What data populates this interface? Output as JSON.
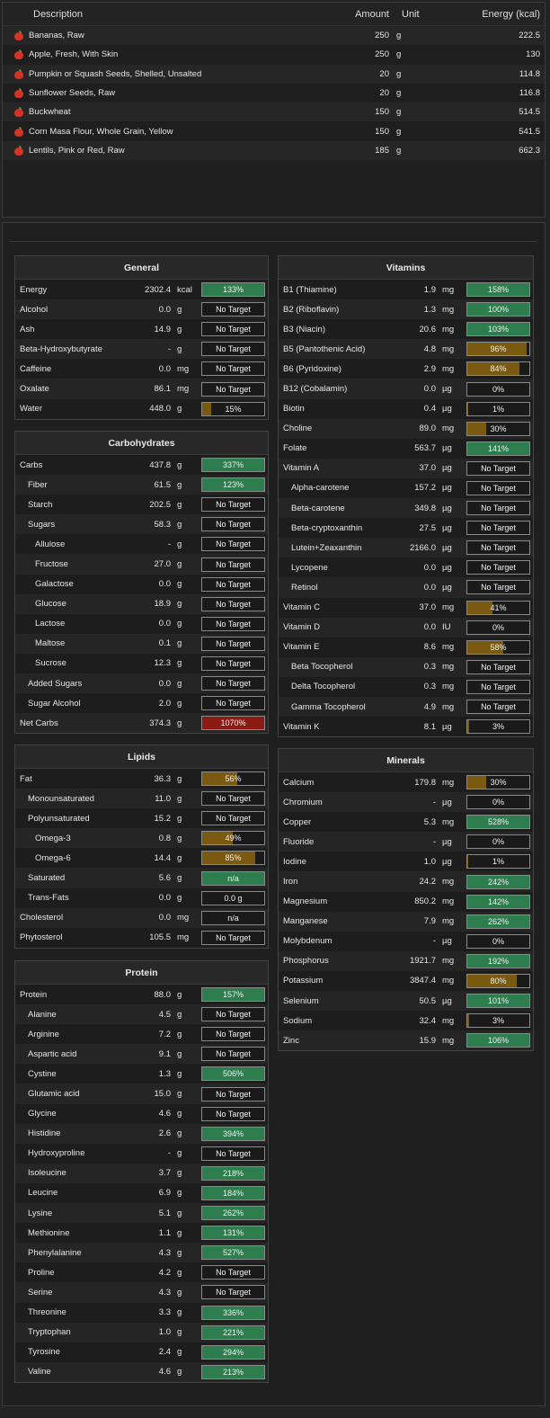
{
  "colors": {
    "green": "#2e7d4f",
    "orange": "#7a5a10",
    "red": "#8b1a12",
    "background": "#232323"
  },
  "food": {
    "headers": {
      "description": "Description",
      "amount": "Amount",
      "unit": "Unit",
      "energy": "Energy (kcal)"
    },
    "icon": "apple-icon",
    "rows": [
      {
        "desc": "Bananas, Raw",
        "amount": "250",
        "unit": "g",
        "energy": "222.5"
      },
      {
        "desc": "Apple, Fresh, With Skin",
        "amount": "250",
        "unit": "g",
        "energy": "130"
      },
      {
        "desc": "Pumpkin or Squash Seeds, Shelled, Unsalted",
        "amount": "20",
        "unit": "g",
        "energy": "114.8"
      },
      {
        "desc": "Sunflower Seeds, Raw",
        "amount": "20",
        "unit": "g",
        "energy": "116.8"
      },
      {
        "desc": "Buckwheat",
        "amount": "150",
        "unit": "g",
        "energy": "514.5"
      },
      {
        "desc": "Corn Masa Flour, Whole Grain, Yellow",
        "amount": "150",
        "unit": "g",
        "energy": "541.5"
      },
      {
        "desc": "Lentils, Pink or Red, Raw",
        "amount": "185",
        "unit": "g",
        "energy": "662.3"
      }
    ]
  },
  "sections": {
    "general": {
      "title": "General",
      "rows": [
        {
          "name": "Energy",
          "value": "2302.4",
          "unit": "kcal",
          "bar": "133%",
          "pct": 133,
          "color": "green",
          "indent": 0
        },
        {
          "name": "Alcohol",
          "value": "0.0",
          "unit": "g",
          "bar": "No Target",
          "pct": 0,
          "color": "none",
          "indent": 0
        },
        {
          "name": "Ash",
          "value": "14.9",
          "unit": "g",
          "bar": "No Target",
          "pct": 0,
          "color": "none",
          "indent": 0
        },
        {
          "name": "Beta-Hydroxybutyrate",
          "value": "-",
          "unit": "g",
          "bar": "No Target",
          "pct": 0,
          "color": "none",
          "indent": 0
        },
        {
          "name": "Caffeine",
          "value": "0.0",
          "unit": "mg",
          "bar": "No Target",
          "pct": 0,
          "color": "none",
          "indent": 0
        },
        {
          "name": "Oxalate",
          "value": "86.1",
          "unit": "mg",
          "bar": "No Target",
          "pct": 0,
          "color": "none",
          "indent": 0
        },
        {
          "name": "Water",
          "value": "448.0",
          "unit": "g",
          "bar": "15%",
          "pct": 15,
          "color": "orange",
          "indent": 0
        }
      ]
    },
    "carbs": {
      "title": "Carbohydrates",
      "rows": [
        {
          "name": "Carbs",
          "value": "437.8",
          "unit": "g",
          "bar": "337%",
          "pct": 337,
          "color": "green",
          "indent": 0
        },
        {
          "name": "Fiber",
          "value": "61.5",
          "unit": "g",
          "bar": "123%",
          "pct": 123,
          "color": "green",
          "indent": 1
        },
        {
          "name": "Starch",
          "value": "202.5",
          "unit": "g",
          "bar": "No Target",
          "pct": 0,
          "color": "none",
          "indent": 1
        },
        {
          "name": "Sugars",
          "value": "58.3",
          "unit": "g",
          "bar": "No Target",
          "pct": 0,
          "color": "none",
          "indent": 1
        },
        {
          "name": "Allulose",
          "value": "-",
          "unit": "g",
          "bar": "No Target",
          "pct": 0,
          "color": "none",
          "indent": 2
        },
        {
          "name": "Fructose",
          "value": "27.0",
          "unit": "g",
          "bar": "No Target",
          "pct": 0,
          "color": "none",
          "indent": 2
        },
        {
          "name": "Galactose",
          "value": "0.0",
          "unit": "g",
          "bar": "No Target",
          "pct": 0,
          "color": "none",
          "indent": 2
        },
        {
          "name": "Glucose",
          "value": "18.9",
          "unit": "g",
          "bar": "No Target",
          "pct": 0,
          "color": "none",
          "indent": 2
        },
        {
          "name": "Lactose",
          "value": "0.0",
          "unit": "g",
          "bar": "No Target",
          "pct": 0,
          "color": "none",
          "indent": 2
        },
        {
          "name": "Maltose",
          "value": "0.1",
          "unit": "g",
          "bar": "No Target",
          "pct": 0,
          "color": "none",
          "indent": 2
        },
        {
          "name": "Sucrose",
          "value": "12.3",
          "unit": "g",
          "bar": "No Target",
          "pct": 0,
          "color": "none",
          "indent": 2
        },
        {
          "name": "Added Sugars",
          "value": "0.0",
          "unit": "g",
          "bar": "No Target",
          "pct": 0,
          "color": "none",
          "indent": 1
        },
        {
          "name": "Sugar Alcohol",
          "value": "2.0",
          "unit": "g",
          "bar": "No Target",
          "pct": 0,
          "color": "none",
          "indent": 1
        },
        {
          "name": "Net Carbs",
          "value": "374.3",
          "unit": "g",
          "bar": "1070%",
          "pct": 1070,
          "color": "red",
          "indent": 0
        }
      ]
    },
    "lipids": {
      "title": "Lipids",
      "rows": [
        {
          "name": "Fat",
          "value": "36.3",
          "unit": "g",
          "bar": "56%",
          "pct": 56,
          "color": "orange",
          "indent": 0
        },
        {
          "name": "Monounsaturated",
          "value": "11.0",
          "unit": "g",
          "bar": "No Target",
          "pct": 0,
          "color": "none",
          "indent": 1
        },
        {
          "name": "Polyunsaturated",
          "value": "15.2",
          "unit": "g",
          "bar": "No Target",
          "pct": 0,
          "color": "none",
          "indent": 1
        },
        {
          "name": "Omega-3",
          "value": "0.8",
          "unit": "g",
          "bar": "49%",
          "pct": 49,
          "color": "orange",
          "indent": 2
        },
        {
          "name": "Omega-6",
          "value": "14.4",
          "unit": "g",
          "bar": "85%",
          "pct": 85,
          "color": "orange",
          "indent": 2
        },
        {
          "name": "Saturated",
          "value": "5.6",
          "unit": "g",
          "bar": "n/a",
          "pct": 100,
          "color": "green",
          "indent": 1
        },
        {
          "name": "Trans-Fats",
          "value": "0.0",
          "unit": "g",
          "bar": "0.0 g",
          "pct": 0,
          "color": "none",
          "indent": 1
        },
        {
          "name": "Cholesterol",
          "value": "0.0",
          "unit": "mg",
          "bar": "n/a",
          "pct": 0,
          "color": "none",
          "indent": 0
        },
        {
          "name": "Phytosterol",
          "value": "105.5",
          "unit": "mg",
          "bar": "No Target",
          "pct": 0,
          "color": "none",
          "indent": 0
        }
      ]
    },
    "protein": {
      "title": "Protein",
      "rows": [
        {
          "name": "Protein",
          "value": "88.0",
          "unit": "g",
          "bar": "157%",
          "pct": 157,
          "color": "green",
          "indent": 0
        },
        {
          "name": "Alanine",
          "value": "4.5",
          "unit": "g",
          "bar": "No Target",
          "pct": 0,
          "color": "none",
          "indent": 1
        },
        {
          "name": "Arginine",
          "value": "7.2",
          "unit": "g",
          "bar": "No Target",
          "pct": 0,
          "color": "none",
          "indent": 1
        },
        {
          "name": "Aspartic acid",
          "value": "9.1",
          "unit": "g",
          "bar": "No Target",
          "pct": 0,
          "color": "none",
          "indent": 1
        },
        {
          "name": "Cystine",
          "value": "1.3",
          "unit": "g",
          "bar": "506%",
          "pct": 506,
          "color": "green",
          "indent": 1
        },
        {
          "name": "Glutamic acid",
          "value": "15.0",
          "unit": "g",
          "bar": "No Target",
          "pct": 0,
          "color": "none",
          "indent": 1
        },
        {
          "name": "Glycine",
          "value": "4.6",
          "unit": "g",
          "bar": "No Target",
          "pct": 0,
          "color": "none",
          "indent": 1
        },
        {
          "name": "Histidine",
          "value": "2.6",
          "unit": "g",
          "bar": "394%",
          "pct": 394,
          "color": "green",
          "indent": 1
        },
        {
          "name": "Hydroxyproline",
          "value": "-",
          "unit": "g",
          "bar": "No Target",
          "pct": 0,
          "color": "none",
          "indent": 1
        },
        {
          "name": "Isoleucine",
          "value": "3.7",
          "unit": "g",
          "bar": "218%",
          "pct": 218,
          "color": "green",
          "indent": 1
        },
        {
          "name": "Leucine",
          "value": "6.9",
          "unit": "g",
          "bar": "184%",
          "pct": 184,
          "color": "green",
          "indent": 1
        },
        {
          "name": "Lysine",
          "value": "5.1",
          "unit": "g",
          "bar": "262%",
          "pct": 262,
          "color": "green",
          "indent": 1
        },
        {
          "name": "Methionine",
          "value": "1.1",
          "unit": "g",
          "bar": "131%",
          "pct": 131,
          "color": "green",
          "indent": 1
        },
        {
          "name": "Phenylalanine",
          "value": "4.3",
          "unit": "g",
          "bar": "527%",
          "pct": 527,
          "color": "green",
          "indent": 1
        },
        {
          "name": "Proline",
          "value": "4.2",
          "unit": "g",
          "bar": "No Target",
          "pct": 0,
          "color": "none",
          "indent": 1
        },
        {
          "name": "Serine",
          "value": "4.3",
          "unit": "g",
          "bar": "No Target",
          "pct": 0,
          "color": "none",
          "indent": 1
        },
        {
          "name": "Threonine",
          "value": "3.3",
          "unit": "g",
          "bar": "336%",
          "pct": 336,
          "color": "green",
          "indent": 1
        },
        {
          "name": "Tryptophan",
          "value": "1.0",
          "unit": "g",
          "bar": "221%",
          "pct": 221,
          "color": "green",
          "indent": 1
        },
        {
          "name": "Tyrosine",
          "value": "2.4",
          "unit": "g",
          "bar": "294%",
          "pct": 294,
          "color": "green",
          "indent": 1
        },
        {
          "name": "Valine",
          "value": "4.6",
          "unit": "g",
          "bar": "213%",
          "pct": 213,
          "color": "green",
          "indent": 1
        }
      ]
    },
    "vitamins": {
      "title": "Vitamins",
      "rows": [
        {
          "name": "B1 (Thiamine)",
          "value": "1.9",
          "unit": "mg",
          "bar": "158%",
          "pct": 158,
          "color": "green",
          "indent": 0
        },
        {
          "name": "B2 (Riboflavin)",
          "value": "1.3",
          "unit": "mg",
          "bar": "100%",
          "pct": 100,
          "color": "green",
          "indent": 0
        },
        {
          "name": "B3 (Niacin)",
          "value": "20.6",
          "unit": "mg",
          "bar": "103%",
          "pct": 103,
          "color": "green",
          "indent": 0
        },
        {
          "name": "B5 (Pantothenic Acid)",
          "value": "4.8",
          "unit": "mg",
          "bar": "96%",
          "pct": 96,
          "color": "orange",
          "indent": 0
        },
        {
          "name": "B6 (Pyridoxine)",
          "value": "2.9",
          "unit": "mg",
          "bar": "84%",
          "pct": 84,
          "color": "orange",
          "indent": 0
        },
        {
          "name": "B12 (Cobalamin)",
          "value": "0.0",
          "unit": "µg",
          "bar": "0%",
          "pct": 0,
          "color": "orange",
          "indent": 0
        },
        {
          "name": "Biotin",
          "value": "0.4",
          "unit": "µg",
          "bar": "1%",
          "pct": 1,
          "color": "orange",
          "indent": 0
        },
        {
          "name": "Choline",
          "value": "89.0",
          "unit": "mg",
          "bar": "30%",
          "pct": 30,
          "color": "orange",
          "indent": 0
        },
        {
          "name": "Folate",
          "value": "563.7",
          "unit": "µg",
          "bar": "141%",
          "pct": 141,
          "color": "green",
          "indent": 0
        },
        {
          "name": "Vitamin A",
          "value": "37.0",
          "unit": "µg",
          "bar": "No Target",
          "pct": 0,
          "color": "none",
          "indent": 0
        },
        {
          "name": "Alpha-carotene",
          "value": "157.2",
          "unit": "µg",
          "bar": "No Target",
          "pct": 0,
          "color": "none",
          "indent": 1
        },
        {
          "name": "Beta-carotene",
          "value": "349.8",
          "unit": "µg",
          "bar": "No Target",
          "pct": 0,
          "color": "none",
          "indent": 1
        },
        {
          "name": "Beta-cryptoxanthin",
          "value": "27.5",
          "unit": "µg",
          "bar": "No Target",
          "pct": 0,
          "color": "none",
          "indent": 1
        },
        {
          "name": "Lutein+Zeaxanthin",
          "value": "2166.0",
          "unit": "µg",
          "bar": "No Target",
          "pct": 0,
          "color": "none",
          "indent": 1
        },
        {
          "name": "Lycopene",
          "value": "0.0",
          "unit": "µg",
          "bar": "No Target",
          "pct": 0,
          "color": "none",
          "indent": 1
        },
        {
          "name": "Retinol",
          "value": "0.0",
          "unit": "µg",
          "bar": "No Target",
          "pct": 0,
          "color": "none",
          "indent": 1
        },
        {
          "name": "Vitamin C",
          "value": "37.0",
          "unit": "mg",
          "bar": "41%",
          "pct": 41,
          "color": "orange",
          "indent": 0
        },
        {
          "name": "Vitamin D",
          "value": "0.0",
          "unit": "IU",
          "bar": "0%",
          "pct": 0,
          "color": "orange",
          "indent": 0
        },
        {
          "name": "Vitamin E",
          "value": "8.6",
          "unit": "mg",
          "bar": "58%",
          "pct": 58,
          "color": "orange",
          "indent": 0
        },
        {
          "name": "Beta Tocopherol",
          "value": "0.3",
          "unit": "mg",
          "bar": "No Target",
          "pct": 0,
          "color": "none",
          "indent": 1
        },
        {
          "name": "Delta Tocopherol",
          "value": "0.3",
          "unit": "mg",
          "bar": "No Target",
          "pct": 0,
          "color": "none",
          "indent": 1
        },
        {
          "name": "Gamma Tocopherol",
          "value": "4.9",
          "unit": "mg",
          "bar": "No Target",
          "pct": 0,
          "color": "none",
          "indent": 1
        },
        {
          "name": "Vitamin K",
          "value": "8.1",
          "unit": "µg",
          "bar": "3%",
          "pct": 3,
          "color": "orange",
          "indent": 0
        }
      ]
    },
    "minerals": {
      "title": "Minerals",
      "rows": [
        {
          "name": "Calcium",
          "value": "179.8",
          "unit": "mg",
          "bar": "30%",
          "pct": 30,
          "color": "orange",
          "indent": 0
        },
        {
          "name": "Chromium",
          "value": "-",
          "unit": "µg",
          "bar": "0%",
          "pct": 0,
          "color": "orange",
          "indent": 0
        },
        {
          "name": "Copper",
          "value": "5.3",
          "unit": "mg",
          "bar": "528%",
          "pct": 528,
          "color": "green",
          "indent": 0
        },
        {
          "name": "Fluoride",
          "value": "-",
          "unit": "µg",
          "bar": "0%",
          "pct": 0,
          "color": "orange",
          "indent": 0
        },
        {
          "name": "Iodine",
          "value": "1.0",
          "unit": "µg",
          "bar": "1%",
          "pct": 1,
          "color": "orange",
          "indent": 0
        },
        {
          "name": "Iron",
          "value": "24.2",
          "unit": "mg",
          "bar": "242%",
          "pct": 242,
          "color": "green",
          "indent": 0
        },
        {
          "name": "Magnesium",
          "value": "850.2",
          "unit": "mg",
          "bar": "142%",
          "pct": 142,
          "color": "green",
          "indent": 0
        },
        {
          "name": "Manganese",
          "value": "7.9",
          "unit": "mg",
          "bar": "262%",
          "pct": 262,
          "color": "green",
          "indent": 0
        },
        {
          "name": "Molybdenum",
          "value": "-",
          "unit": "µg",
          "bar": "0%",
          "pct": 0,
          "color": "orange",
          "indent": 0
        },
        {
          "name": "Phosphorus",
          "value": "1921.7",
          "unit": "mg",
          "bar": "192%",
          "pct": 192,
          "color": "green",
          "indent": 0
        },
        {
          "name": "Potassium",
          "value": "3847.4",
          "unit": "mg",
          "bar": "80%",
          "pct": 80,
          "color": "orange",
          "indent": 0
        },
        {
          "name": "Selenium",
          "value": "50.5",
          "unit": "µg",
          "bar": "101%",
          "pct": 101,
          "color": "green",
          "indent": 0
        },
        {
          "name": "Sodium",
          "value": "32.4",
          "unit": "mg",
          "bar": "3%",
          "pct": 3,
          "color": "orange",
          "indent": 0
        },
        {
          "name": "Zinc",
          "value": "15.9",
          "unit": "mg",
          "bar": "106%",
          "pct": 106,
          "color": "green",
          "indent": 0
        }
      ]
    }
  }
}
